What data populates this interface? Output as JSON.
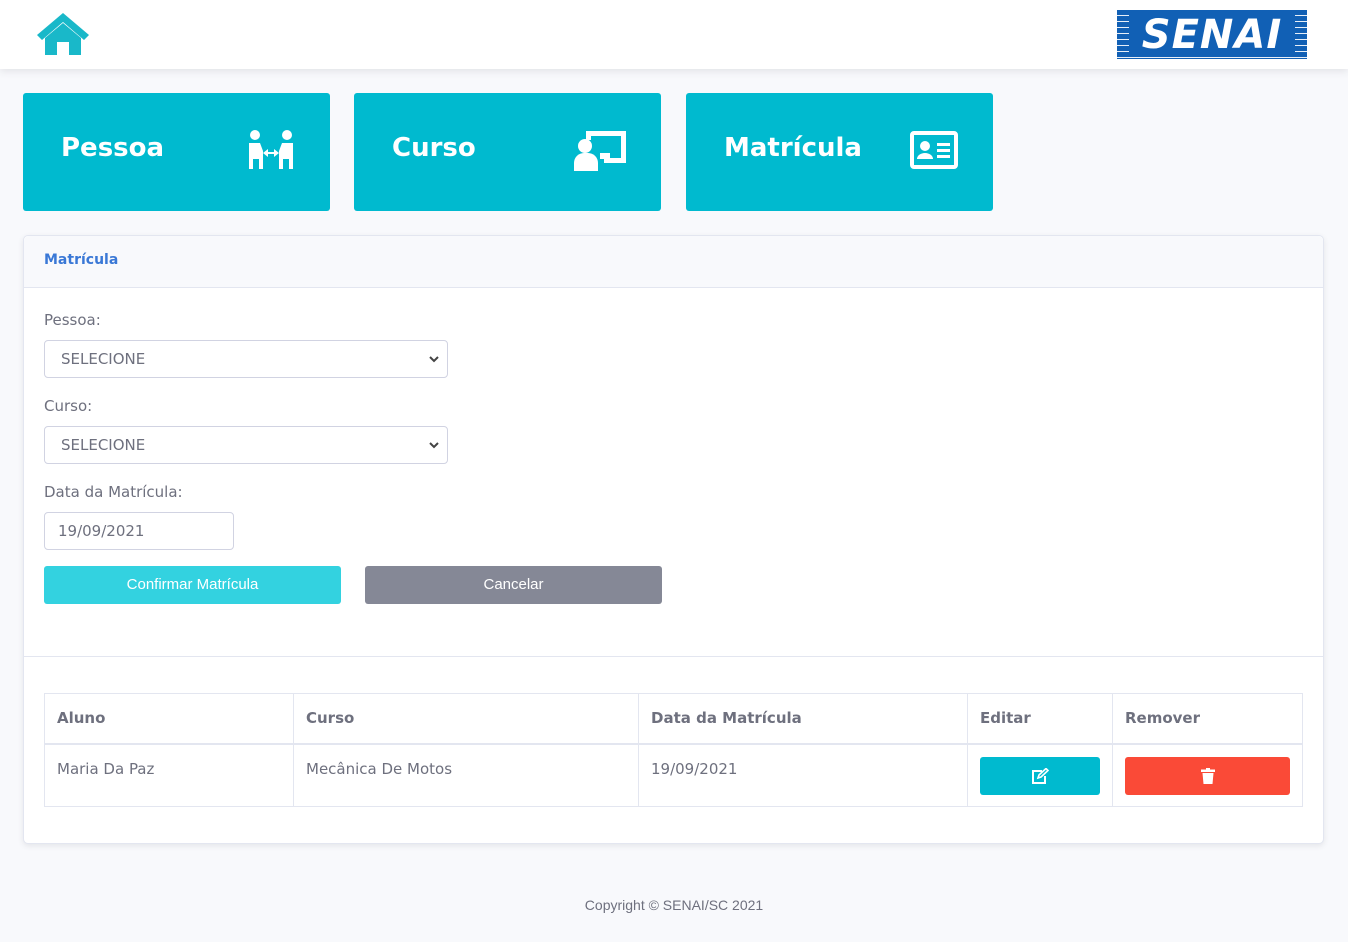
{
  "topbar": {
    "home_icon": "home-icon",
    "logo_text": "SENAI"
  },
  "tiles": [
    {
      "label": "Pessoa",
      "icon": "people-arrows-icon"
    },
    {
      "label": "Curso",
      "icon": "chalkboard-teacher-icon"
    },
    {
      "label": "Matrícula",
      "icon": "id-card-icon"
    }
  ],
  "card": {
    "title": "Matrícula",
    "pessoa_label": "Pessoa:",
    "pessoa_value": "SELECIONE",
    "curso_label": "Curso:",
    "curso_value": "SELECIONE",
    "data_label": "Data da Matrícula:",
    "data_value": "19/09/2021",
    "confirm_label": "Confirmar Matrícula",
    "cancel_label": "Cancelar"
  },
  "table": {
    "headers": [
      "Aluno",
      "Curso",
      "Data da Matrícula",
      "Editar",
      "Remover"
    ],
    "rows": [
      {
        "aluno": "Maria Da Paz",
        "curso": "Mecânica De Motos",
        "data": "19/09/2021",
        "edit_icon": "edit-icon",
        "remove_icon": "trash-icon"
      }
    ]
  },
  "footer": {
    "copyright": "Copyright © SENAI/SC 2021"
  },
  "colors": {
    "accent": "#00bacf",
    "danger": "#fa4a37",
    "secondary": "#858896",
    "title": "#3a78d6"
  }
}
